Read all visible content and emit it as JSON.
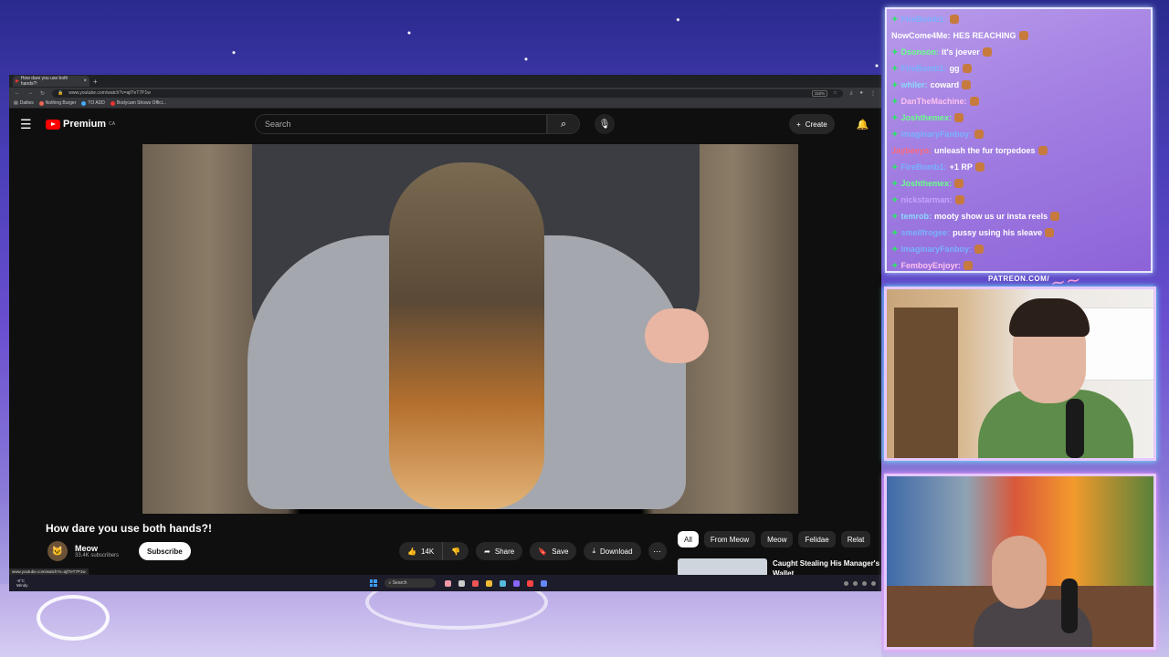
{
  "browser": {
    "tab_title": "How dare you use both hands?!",
    "url": "www.youtube.com/watch?v=ajf7eT7P1w",
    "zoom": "150%",
    "bookmarks": [
      "Dailies",
      "Nothing Burger",
      "TO ADD",
      "Bodycam Shows Offici..."
    ],
    "status_url": "www.youtube.com/watch?v=ajf7eT7P1w"
  },
  "youtube": {
    "logo_text": "Premium",
    "logo_sup": "CA",
    "search_placeholder": "Search",
    "create_label": "Create",
    "video_title": "How dare you use both hands?!",
    "channel_name": "Meow",
    "subscribers": "33.4K subscribers",
    "subscribe_label": "Subscribe",
    "likes": "14K",
    "share_label": "Share",
    "save_label": "Save",
    "download_label": "Download",
    "chips": [
      "All",
      "From Meow",
      "Meow",
      "Felidae",
      "Relat"
    ],
    "recommendation_title": "Caught Stealing His Manager's Wallet"
  },
  "taskbar": {
    "weather_temp": "-9°C",
    "weather_desc": "Windy",
    "search_label": "Search"
  },
  "chat": {
    "messages": [
      {
        "user": "FireBomb1:",
        "text": "",
        "color": "blue",
        "badge": true
      },
      {
        "user": "NowCome4Me:",
        "text": "HES REACHING",
        "color": "white",
        "badge": false
      },
      {
        "user": "Dsonson:",
        "text": "it's joever",
        "color": "green",
        "badge": true
      },
      {
        "user": "FireBomb1:",
        "text": "gg",
        "color": "blue",
        "badge": true
      },
      {
        "user": "whiler:",
        "text": "coward",
        "color": "cyan",
        "badge": true
      },
      {
        "user": "DanTheMachine:",
        "text": "",
        "color": "pink",
        "badge": true
      },
      {
        "user": "Joshthemex:",
        "text": "",
        "color": "green",
        "badge": true
      },
      {
        "user": "ImaginaryFanboy:",
        "text": "",
        "color": "blue",
        "badge": true
      },
      {
        "user": "Jaybeeyo:",
        "text": "unleash the fur torpedoes",
        "color": "red",
        "badge": false
      },
      {
        "user": "FireBomb1:",
        "text": "+1 RP",
        "color": "blue",
        "badge": true
      },
      {
        "user": "Joshthemex:",
        "text": "",
        "color": "green",
        "badge": true
      },
      {
        "user": "nickstarman:",
        "text": "",
        "color": "lavender",
        "badge": true
      },
      {
        "user": "temrob:",
        "text": "mooty show us ur insta reels",
        "color": "cyan",
        "badge": true
      },
      {
        "user": "smellfrogee:",
        "text": "pussy using his sleave",
        "color": "blue",
        "badge": true
      },
      {
        "user": "ImaginaryFanboy:",
        "text": "",
        "color": "blue",
        "badge": true
      },
      {
        "user": "FemboyEnjoyr:",
        "text": "",
        "color": "pink",
        "badge": true
      }
    ]
  },
  "overlay": {
    "patreon": "PATREON.COM/"
  }
}
